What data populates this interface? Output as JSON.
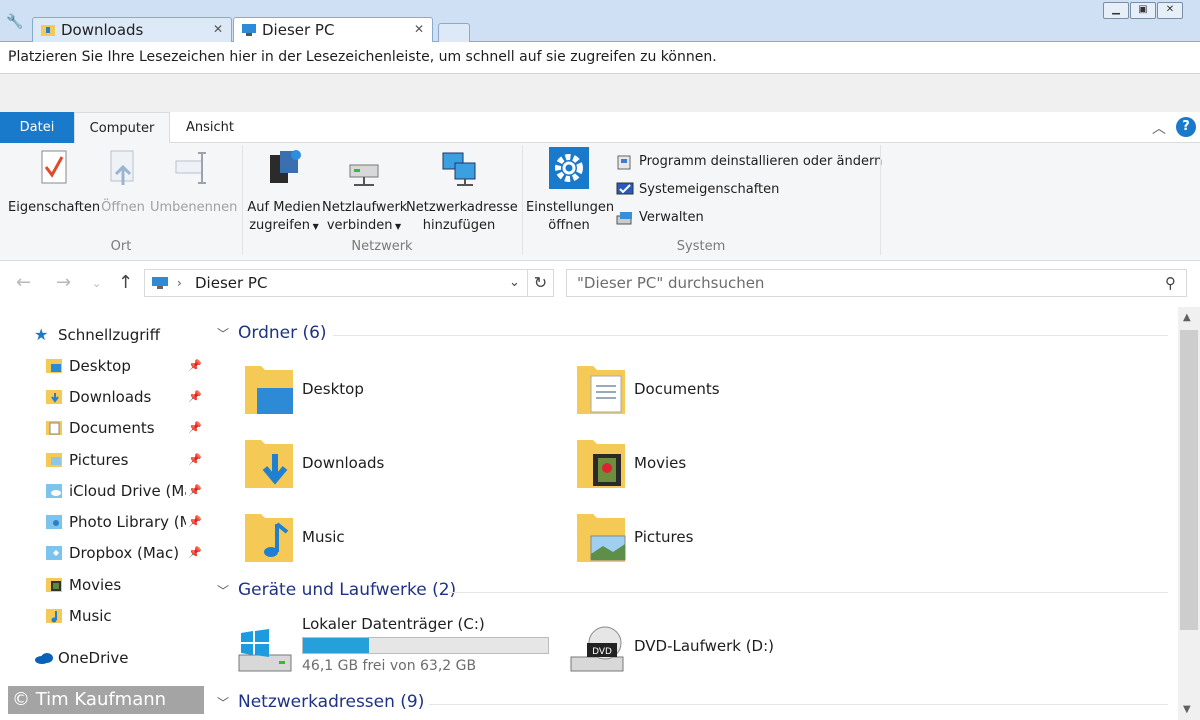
{
  "tabs": [
    {
      "label": "Downloads",
      "active": false,
      "icon": "downloads-folder-icon"
    },
    {
      "label": "Dieser PC",
      "active": true,
      "icon": "this-pc-icon"
    }
  ],
  "bookmark_bar": {
    "text": "Platzieren Sie Ihre Lesezeichen hier in der Lesezeichenleiste, um schnell auf sie zugreifen zu können."
  },
  "ribbon_tabs": {
    "file": "Datei",
    "computer": "Computer",
    "view": "Ansicht"
  },
  "ribbon": {
    "groups": {
      "ort": "Ort",
      "netzwerk": "Netzwerk",
      "system": "System"
    },
    "eigenschaften": "Eigenschaften",
    "oeffnen": "Öffnen",
    "umbenennen": "Umbenennen",
    "auf_medien_1": "Auf Medien",
    "auf_medien_2": "zugreifen",
    "netzlaufwerk_1": "Netzlaufwerk",
    "netzlaufwerk_2": "verbinden",
    "netzwerkadresse_1": "Netzwerkadresse",
    "netzwerkadresse_2": "hinzufügen",
    "einstellungen_1": "Einstellungen",
    "einstellungen_2": "öffnen",
    "programm": "Programm deinstallieren oder ändern",
    "systemeigenschaften": "Systemeigenschaften",
    "verwalten": "Verwalten"
  },
  "address": {
    "path": "Dieser PC",
    "search_placeholder": "\"Dieser PC\" durchsuchen"
  },
  "nav": {
    "quick_access": "Schnellzugriff",
    "items": [
      {
        "label": "Desktop",
        "pinned": true
      },
      {
        "label": "Downloads",
        "pinned": true
      },
      {
        "label": "Documents",
        "pinned": true
      },
      {
        "label": "Pictures",
        "pinned": true
      },
      {
        "label": "iCloud Drive (Ma",
        "pinned": true
      },
      {
        "label": "Photo Library (M",
        "pinned": true
      },
      {
        "label": "Dropbox (Mac)",
        "pinned": true
      },
      {
        "label": "Movies",
        "pinned": false
      },
      {
        "label": "Music",
        "pinned": false
      }
    ],
    "onedrive": "OneDrive"
  },
  "content": {
    "folders_header": "Ordner (6)",
    "folders": [
      {
        "name": "Desktop"
      },
      {
        "name": "Documents"
      },
      {
        "name": "Downloads"
      },
      {
        "name": "Movies"
      },
      {
        "name": "Music"
      },
      {
        "name": "Pictures"
      }
    ],
    "devices_header": "Geräte und Laufwerke (2)",
    "drive_c": {
      "name": "Lokaler Datenträger (C:)",
      "free_text": "46,1 GB frei von 63,2 GB",
      "used_fraction": 0.27
    },
    "drive_d": {
      "name": "DVD-Laufwerk (D:)"
    },
    "network_header": "Netzwerkadressen (9)"
  },
  "watermark": "© Tim Kaufmann",
  "colors": {
    "accent": "#1979ca",
    "group_header": "#1e3287",
    "drive_fill": "#26a0da",
    "folder": "#f4c956"
  }
}
